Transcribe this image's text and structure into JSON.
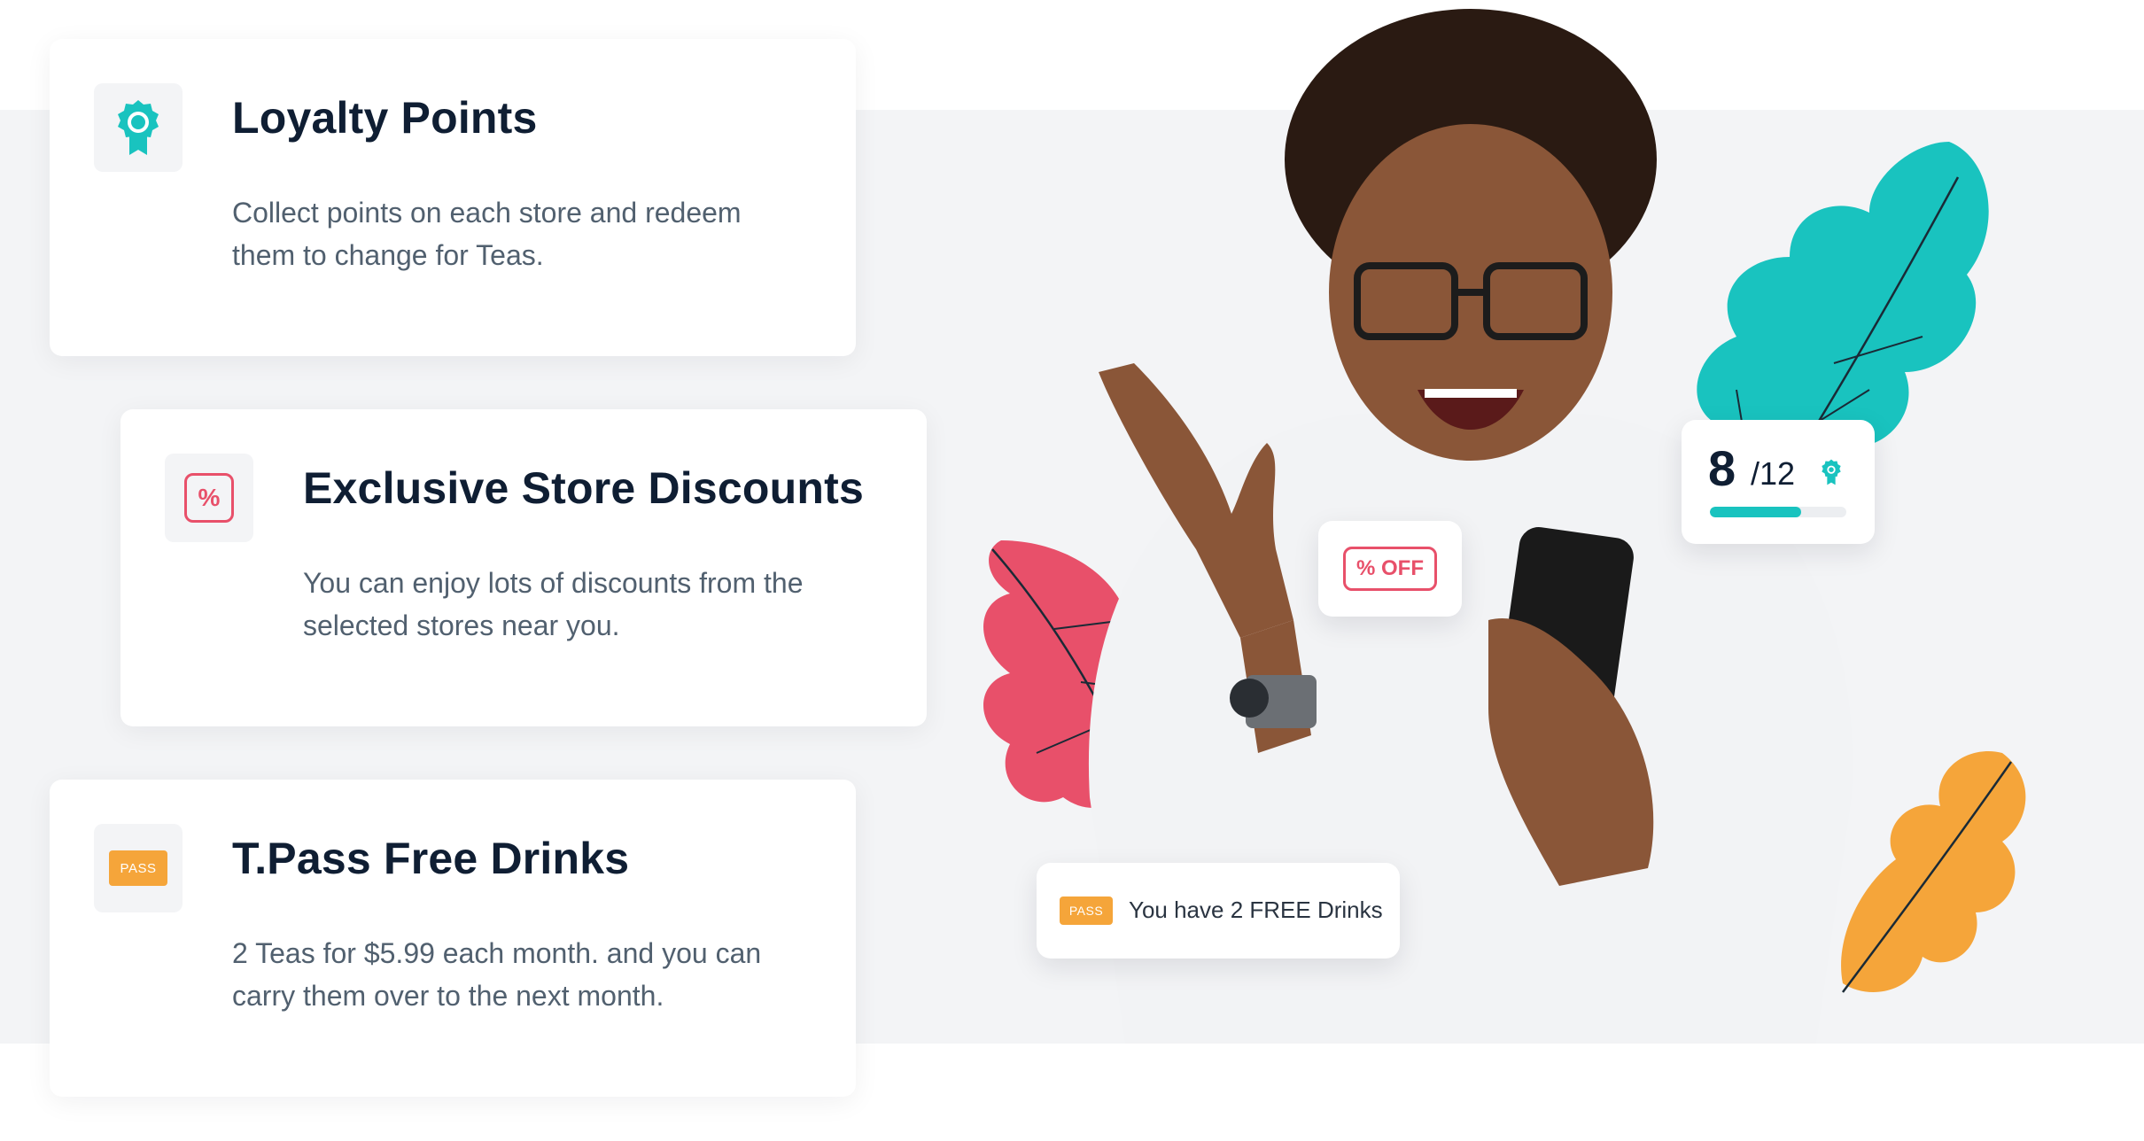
{
  "features": [
    {
      "title": "Loyalty Points",
      "description": "Collect points on each store and redeem them to change for Teas.",
      "icon": "loyalty-badge-icon",
      "accent": "#19c3bf"
    },
    {
      "title": "Exclusive Store Discounts",
      "description": "You can enjoy lots of discounts from the selected stores near you.",
      "icon": "percent-discount-icon",
      "icon_text": "%",
      "accent": "#e8506a"
    },
    {
      "title": "T.Pass Free Drinks",
      "description": "2 Teas for $5.99 each month. and you can carry them over to the next month.",
      "icon": "pass-ticket-icon",
      "icon_text": "PASS",
      "accent": "#f5a53a"
    }
  ],
  "badges": {
    "discount": {
      "label": "% OFF",
      "color": "#e8506a"
    },
    "points": {
      "current": "8",
      "total": "/12",
      "progress": 0.67,
      "icon": "loyalty-badge-icon",
      "color": "#19c3bf"
    },
    "pass": {
      "chip": "PASS",
      "text": "You have 2 FREE Drinks",
      "color": "#f5a53a"
    }
  },
  "illustration": {
    "subject": "woman-with-phone",
    "leaf_colors": {
      "teal": "#19c3bf",
      "red": "#e8506a",
      "orange": "#f5a53a"
    }
  }
}
